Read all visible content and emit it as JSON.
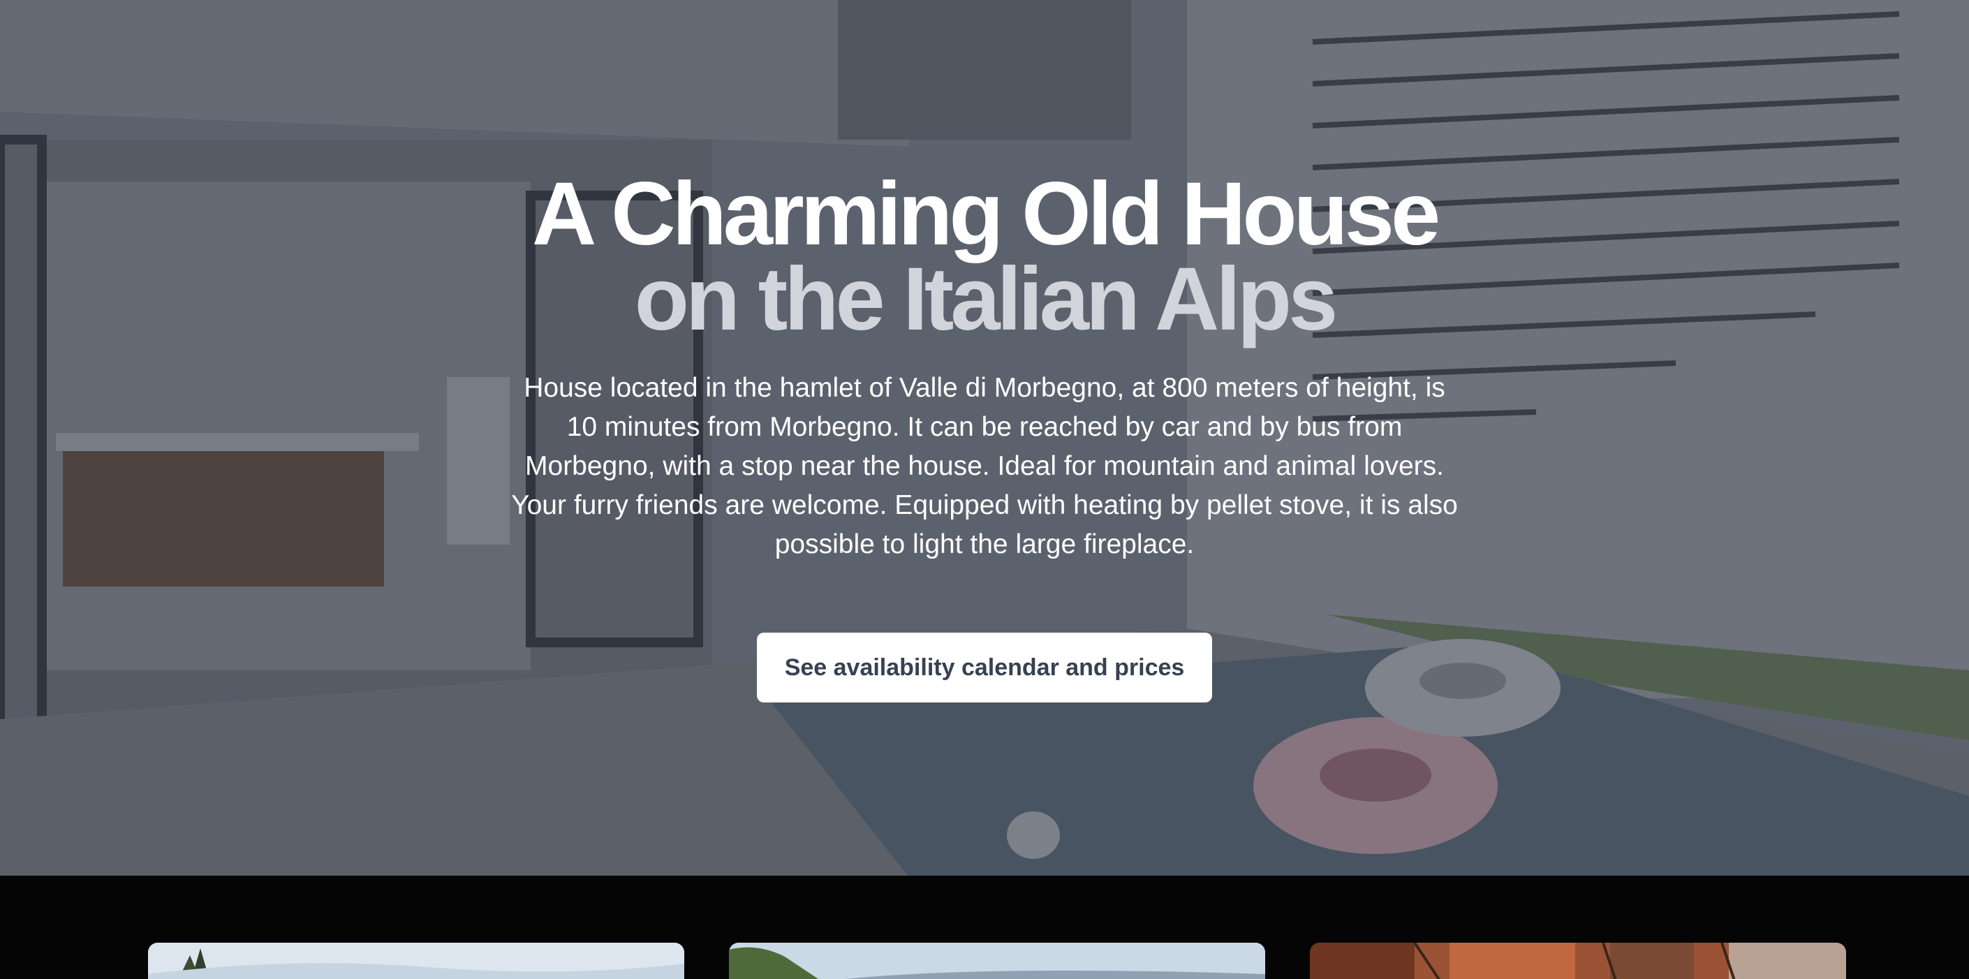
{
  "hero": {
    "title_line1": "A Charming Old House",
    "title_line2": "on the Italian Alps",
    "description": "House located in the hamlet of Valle di Morbegno, at 800 meters of height, is 10 minutes from Morbegno. It can be reached by car and by bus from Morbegno, with a stop near the house. Ideal for mountain and animal lovers. Your furry friends are welcome. Equipped with heating by pellet stove, it is also possible to light the large fireplace.",
    "cta_label": "See availability calendar and prices",
    "background_image": "house-patio-pool-photo"
  },
  "gallery": {
    "cards": [
      {
        "image": "mountain-sky-photo"
      },
      {
        "image": "valley-hills-photo"
      },
      {
        "image": "rustic-interior-photo"
      }
    ]
  },
  "colors": {
    "title_primary": "#ffffff",
    "title_secondary": "#d1d5db",
    "cta_background": "#ffffff",
    "cta_text": "#374151",
    "page_background": "#050505"
  }
}
